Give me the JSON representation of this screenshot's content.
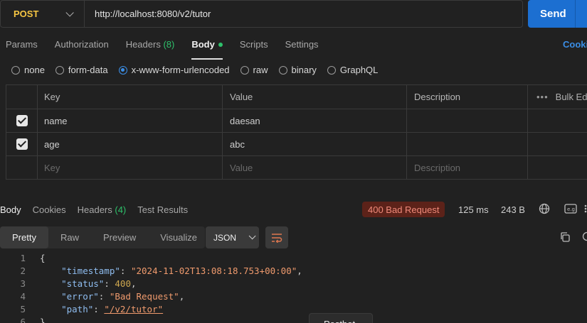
{
  "request": {
    "method": "POST",
    "url": "http://localhost:8080/v2/tutor",
    "send_label": "Send"
  },
  "request_tabs": [
    {
      "label": "Params"
    },
    {
      "label": "Authorization"
    },
    {
      "label": "Headers",
      "count": "(8)"
    },
    {
      "label": "Body"
    },
    {
      "label": "Scripts"
    },
    {
      "label": "Settings"
    }
  ],
  "cookies_label": "Cookies",
  "body_types": [
    "none",
    "form-data",
    "x-www-form-urlencoded",
    "raw",
    "binary",
    "GraphQL"
  ],
  "params_table": {
    "headers": {
      "key": "Key",
      "value": "Value",
      "description": "Description",
      "bulk": "Bulk Edit"
    },
    "rows": [
      {
        "key": "name",
        "value": "daesan"
      },
      {
        "key": "age",
        "value": "abc"
      }
    ],
    "placeholder": {
      "key": "Key",
      "value": "Value",
      "description": "Description"
    }
  },
  "response_tabs": [
    {
      "label": "Body"
    },
    {
      "label": "Cookies"
    },
    {
      "label": "Headers",
      "count": "(4)"
    },
    {
      "label": "Test Results"
    }
  ],
  "response_status": {
    "status": "400 Bad Request",
    "time": "125 ms",
    "size": "243 B"
  },
  "view_modes": [
    "Pretty",
    "Raw",
    "Preview",
    "Visualize"
  ],
  "format": "JSON",
  "code_lines": {
    "l1": "{",
    "l2_key": "\"timestamp\"",
    "l2_val": "\"2024-11-02T13:08:18.753+00:00\"",
    "l3_key": "\"status\"",
    "l3_val": "400",
    "l4_key": "\"error\"",
    "l4_val": "\"Bad Request\"",
    "l5_key": "\"path\"",
    "l5_val": "\"/v2/tutor\"",
    "l6": "}"
  },
  "tooltip": "Postbot",
  "colors": {
    "accent": "#1c6fd1",
    "method": "#f5c543",
    "error_badge": "#5c2219"
  }
}
